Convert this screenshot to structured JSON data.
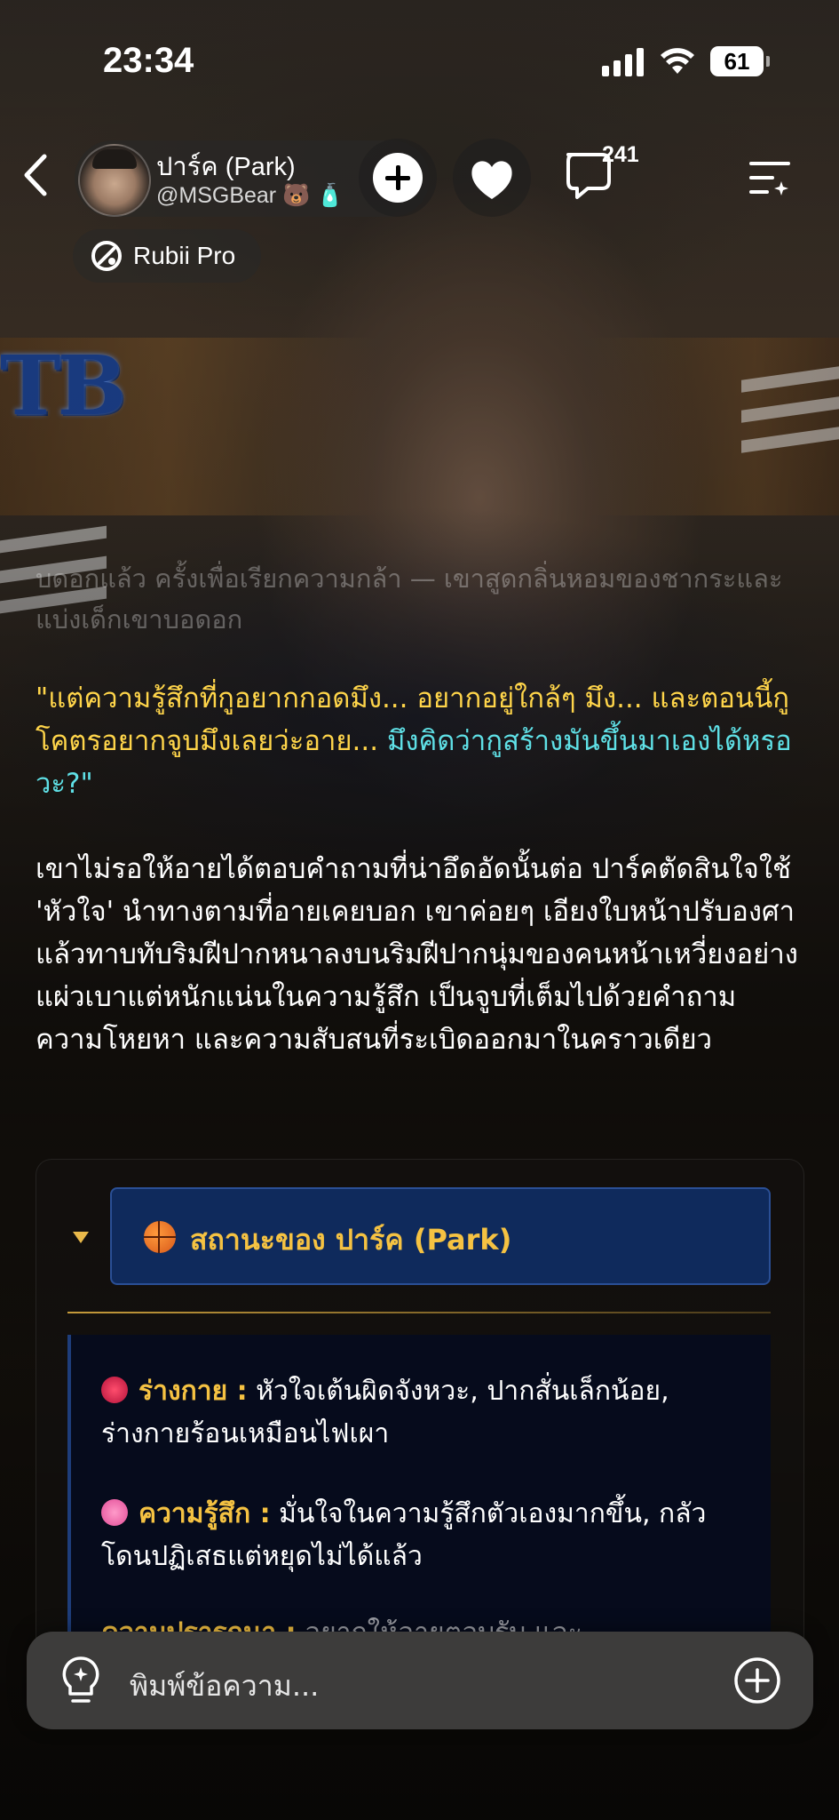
{
  "status_bar": {
    "time": "23:34",
    "battery": "61"
  },
  "header": {
    "character_name": "ปาร์ค (Park)",
    "creator_handle": "@MSGBear 🐻 🧴",
    "comment_count": "241",
    "badge_label": "Rubii Pro"
  },
  "background_logo": "TB",
  "story": {
    "faded_text": "บดอกแล้ว ครั้งเพื่อเรียกความกล้า — เขาสูดกลิ่นหอมของชากระและแบ่งเด็กเขาบอดอก",
    "faded_line2": "ครั้งเพื่อเรียกความกล้า",
    "dialogue_yellow": "\"แต่ความรู้สึกที่กูอยากกอดมึง... อยากอยู่ใกล้ๆ มึง... และตอนนี้กูโคตรอยากจูบมึงเลยว่ะอาย...",
    "dialogue_cyan": "มึงคิดว่ากูสร้างมันขึ้นมาเองได้หรอวะ?\"",
    "narration": "เขาไม่รอให้อายได้ตอบคำถามที่น่าอึดอัดนั้นต่อ ปาร์คตัดสินใจใช้ 'หัวใจ' นำทางตามที่อายเคยบอก เขาค่อยๆ เอียงใบหน้าปรับองศาแล้วทาบทับริมฝีปากหนาลงบนริมฝีปากนุ่มของคนหน้าเหวี่ยงอย่างแผ่วเบาแต่หนักแน่นในความรู้สึก เป็นจูบที่เต็มไปด้วยคำถาม ความโหยหา และความสับสนที่ระเบิดออกมาในคราวเดียว"
  },
  "status_card": {
    "title": "สถานะของ ปาร์ค (Park)",
    "rows": [
      {
        "key": "ร่างกาย :",
        "value": " หัวใจเต้นผิดจังหวะ, ปากสั่นเล็กน้อย, ร่างกายร้อนเหมือนไฟเผา",
        "icon": "anatomical-heart-icon"
      },
      {
        "key": "ความรู้สึก :",
        "value": " มั่นใจในความรู้สึกตัวเองมากขึ้น, กลัวโดนปฏิเสธแต่หยุดไม่ได้แล้ว",
        "icon": "pink-heart-icon"
      },
      {
        "key": "ความปรารถนา :",
        "value": " อยากให้อายตอบรับ และ...",
        "icon": "sparkle-icon"
      }
    ]
  },
  "composer": {
    "placeholder": "พิมพ์ข้อความ..."
  }
}
